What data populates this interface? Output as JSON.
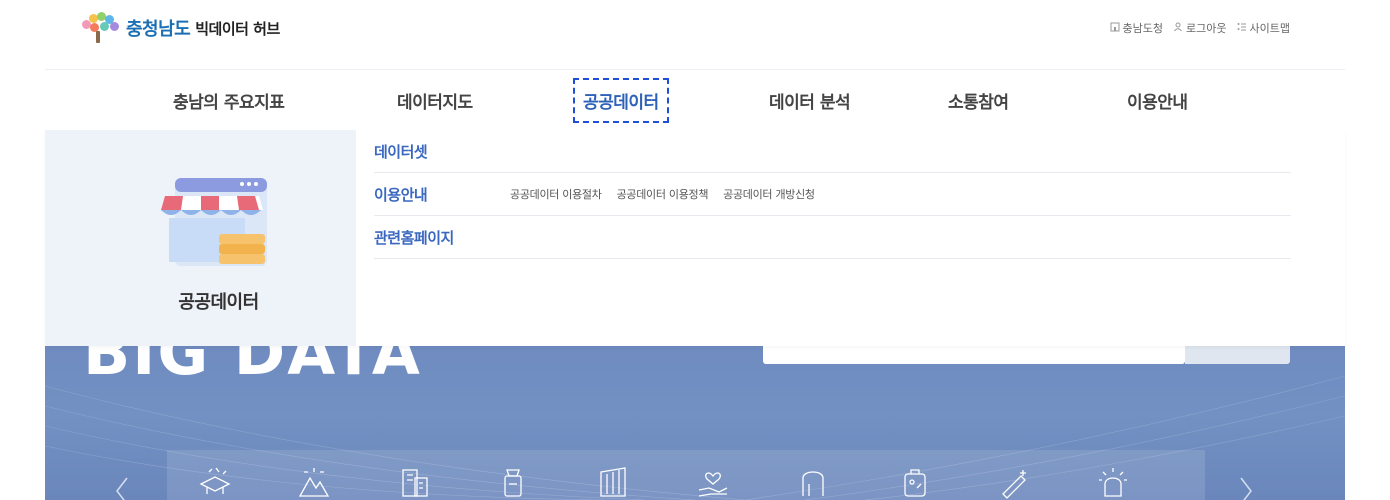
{
  "header": {
    "logo_region": "충청남도",
    "logo_sub": "빅데이터 허브",
    "util_links": [
      {
        "label": "충남도청",
        "icon": "building-icon"
      },
      {
        "label": "로그아웃",
        "icon": "user-icon"
      },
      {
        "label": "사이트맵",
        "icon": "sitemap-icon"
      }
    ]
  },
  "gnb": {
    "items": [
      {
        "label": "충남의 주요지표"
      },
      {
        "label": "데이터지도"
      },
      {
        "label": "공공데이터",
        "active": true
      },
      {
        "label": "데이터 분석"
      },
      {
        "label": "소통참여"
      },
      {
        "label": "이용안내"
      }
    ]
  },
  "dropdown": {
    "side_title": "공공데이터",
    "illustration": "storefront-icon",
    "rows": [
      {
        "title": "데이터셋",
        "subs": []
      },
      {
        "title": "이용안내",
        "subs": [
          "공공데이터 이용절차",
          "공공데이터 이용정책",
          "공공데이터 개방신청"
        ]
      },
      {
        "title": "관련홈페이지",
        "subs": []
      }
    ]
  },
  "hero": {
    "title": "BIG DATA",
    "category_icons": [
      "education-icon",
      "environment-icon",
      "building-icon",
      "food-icon",
      "culture-icon",
      "welfare-icon",
      "agriculture-icon",
      "safety-icon",
      "health-icon",
      "emergency-icon"
    ]
  },
  "colors": {
    "accent": "#2e62b8",
    "hero_bg": "#7391c3",
    "dropdown_side_bg": "#eef2f9"
  }
}
